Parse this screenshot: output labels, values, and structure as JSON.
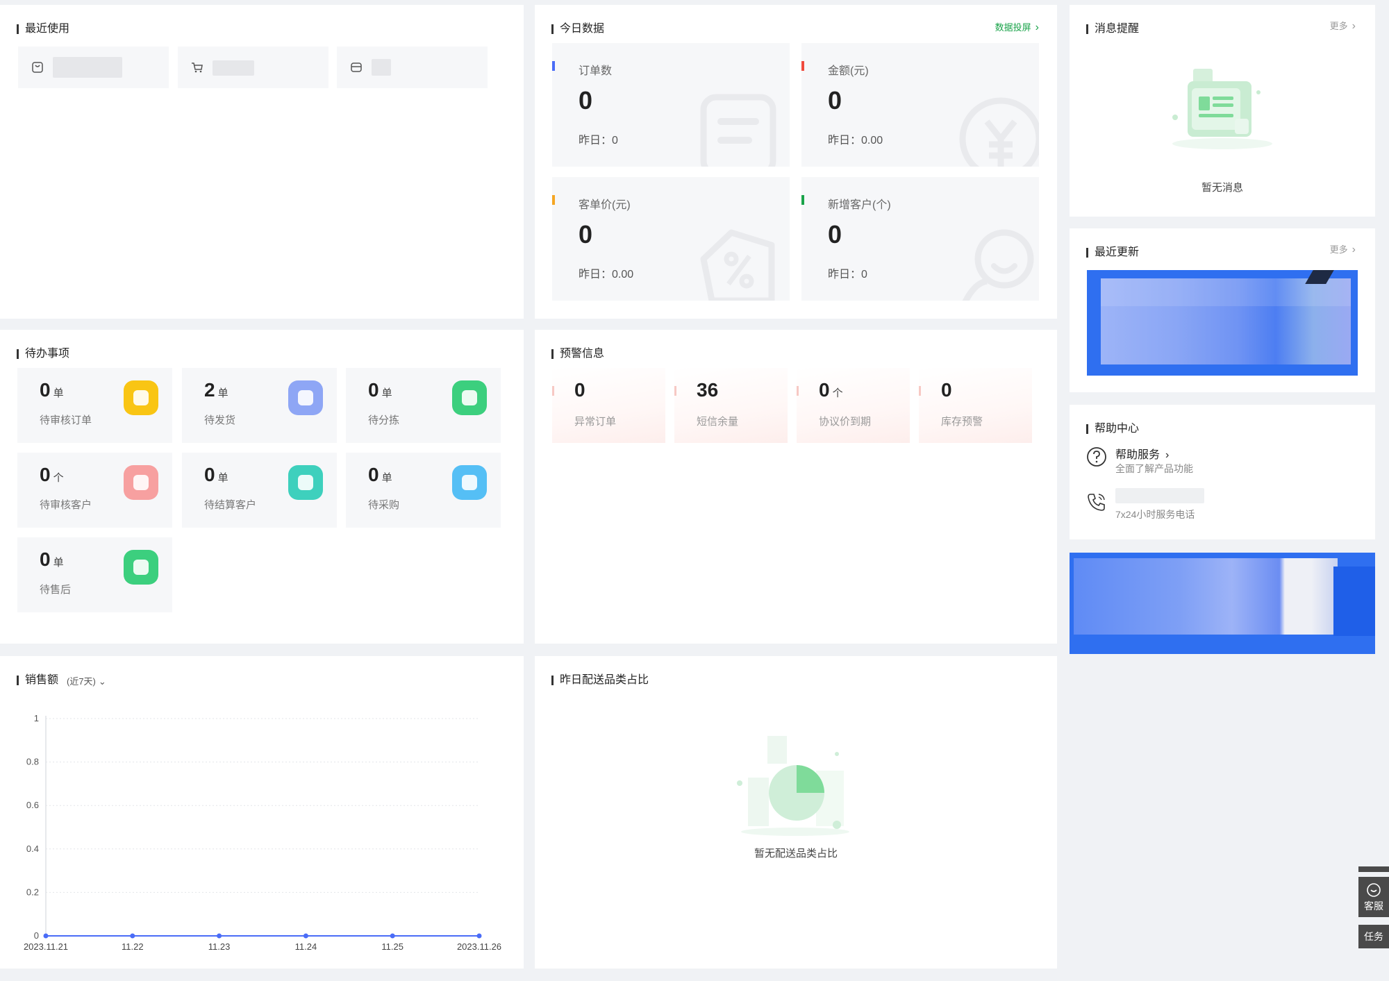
{
  "recent": {
    "title": "最近使用",
    "items": [
      {
        "icon": "bag-icon"
      },
      {
        "icon": "cart-icon"
      },
      {
        "icon": "wallet-icon"
      }
    ]
  },
  "today": {
    "title": "今日数据",
    "screen_link": "数据投屏",
    "stats": [
      {
        "label": "订单数",
        "value": "0",
        "yesterday": "昨日：0",
        "color": "#4a6cf7",
        "icon": "document-icon"
      },
      {
        "label": "金额(元)",
        "value": "0",
        "yesterday": "昨日：0.00",
        "color": "#f04a3e",
        "icon": "yen-icon"
      },
      {
        "label": "客单价(元)",
        "value": "0",
        "yesterday": "昨日：0.00",
        "color": "#f5a623",
        "icon": "discount-tag-icon"
      },
      {
        "label": "新增客户(个)",
        "value": "0",
        "yesterday": "昨日：0",
        "color": "#1aa34a",
        "icon": "user-icon"
      }
    ]
  },
  "messages": {
    "title": "消息提醒",
    "more": "更多",
    "empty": "暂无消息"
  },
  "updates": {
    "title": "最近更新",
    "more": "更多"
  },
  "help": {
    "title": "帮助中心",
    "service_title": "帮助服务",
    "service_desc": "全面了解产品功能",
    "phone_desc": "7x24小时服务电话"
  },
  "todo": {
    "title": "待办事项",
    "items": [
      {
        "value": "0",
        "unit": "单",
        "label": "待审核订单",
        "color": "#f9c514",
        "icon": "clock-icon"
      },
      {
        "value": "2",
        "unit": "单",
        "label": "待发货",
        "color": "#8ea6f5",
        "icon": "box-icon"
      },
      {
        "value": "0",
        "unit": "单",
        "label": "待分拣",
        "color": "#3ccf7e",
        "icon": "sort-icon"
      },
      {
        "value": "0",
        "unit": "个",
        "label": "待审核客户",
        "color": "#f7a0a0",
        "icon": "person-icon"
      },
      {
        "value": "0",
        "unit": "单",
        "label": "待结算客户",
        "color": "#3ed0bd",
        "icon": "dollar-icon"
      },
      {
        "value": "0",
        "unit": "单",
        "label": "待采购",
        "color": "#55bff5",
        "icon": "purchase-icon"
      },
      {
        "value": "0",
        "unit": "单",
        "label": "待售后",
        "color": "#3ccf7e",
        "icon": "aftersale-icon"
      }
    ]
  },
  "warning": {
    "title": "预警信息",
    "items": [
      {
        "value": "0",
        "unit": "",
        "label": "异常订单"
      },
      {
        "value": "36",
        "unit": "",
        "label": "短信余量"
      },
      {
        "value": "0",
        "unit": "个",
        "label": "协议价到期"
      },
      {
        "value": "0",
        "unit": "",
        "label": "库存预警"
      }
    ]
  },
  "sales": {
    "title": "销售额",
    "range": "(近7天)"
  },
  "category": {
    "title": "昨日配送品类占比",
    "empty": "暂无配送品类占比"
  },
  "side": {
    "service": "客服",
    "task": "任务"
  },
  "chart_data": {
    "type": "line",
    "x": [
      "2023.11.21",
      "11.22",
      "11.23",
      "11.24",
      "11.25",
      "2023.11.26"
    ],
    "series": [
      {
        "values": [
          0,
          0,
          0,
          0,
          0,
          0
        ]
      }
    ],
    "ylim": [
      0,
      1
    ],
    "yticks": [
      "0",
      "0.2",
      "0.4",
      "0.6",
      "0.8",
      "1"
    ],
    "grid": true,
    "color": "#4a6cf7"
  }
}
